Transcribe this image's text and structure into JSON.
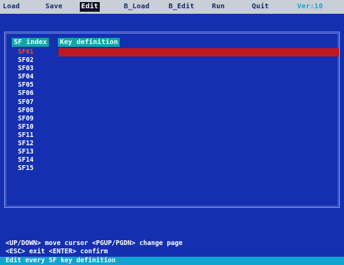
{
  "menu": {
    "load": "Load",
    "save": "Save",
    "edit": "Edit",
    "b_load": "B_Load",
    "b_edit": "B_Edit",
    "run": "Run",
    "quit": "Quit",
    "version": "Ver:10"
  },
  "table": {
    "col_index": "SF index",
    "col_definition": "Key definition",
    "selected_index": 0,
    "rows": [
      "SF01",
      "SF02",
      "SF03",
      "SF04",
      "SF05",
      "SF06",
      "SF07",
      "SF08",
      "SF09",
      "SF10",
      "SF11",
      "SF12",
      "SF13",
      "SF14",
      "SF15"
    ]
  },
  "help": {
    "line1": "<UP/DOWN> move cursor <PGUP/PGDN> change page",
    "line2": "<ESC> exit   <ENTER> confirm"
  },
  "status": "Edit every SF key definition",
  "colors": {
    "background": "#142fb0",
    "menu_bar": "#c9cfd6",
    "header": "#0ea6a6",
    "selection": "#c01822",
    "status_bar": "#12a4cf"
  }
}
